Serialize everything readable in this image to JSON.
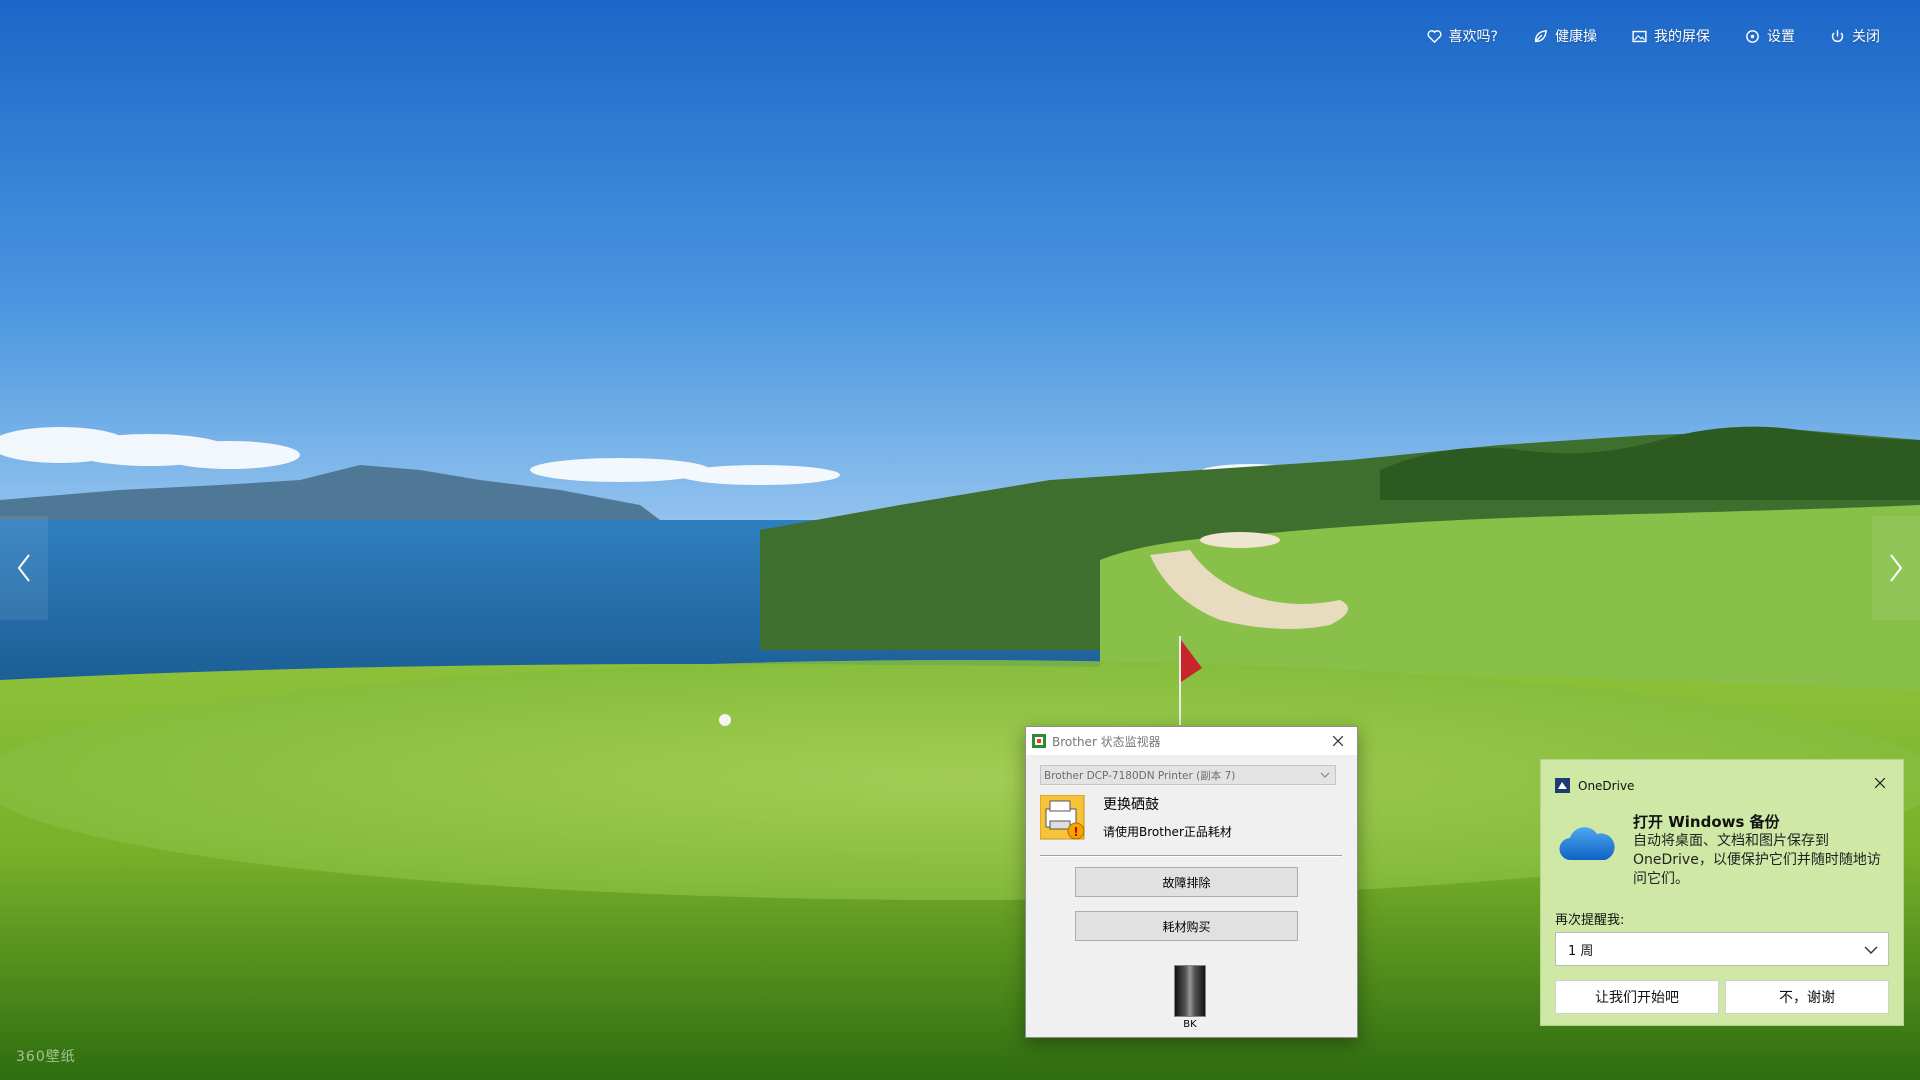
{
  "topnav": {
    "like": "喜欢吗?",
    "health": "健康操",
    "my_screensaver": "我的屏保",
    "settings": "设置",
    "close": "关闭"
  },
  "watermark": "360壁纸",
  "brother_dialog": {
    "title": "Brother 状态监视器",
    "printer_select": "Brother DCP-7180DN Printer (副本 7)",
    "status_main": "更换硒鼓",
    "status_sub": "请使用Brother正品耗材",
    "troubleshoot_button": "故障排除",
    "buy_supplies_button": "耗材购买",
    "toner_label": "BK",
    "toner_level": 1.0,
    "icon": "printer-warning-icon"
  },
  "onedrive_toast": {
    "app_name": "OneDrive",
    "title": "打开 Windows 备份",
    "body": "自动将桌面、文档和图片保存到 OneDrive，以便保护它们并随时随地访问它们。",
    "remind_label": "再次提醒我:",
    "remind_value": "1 周",
    "start_button": "让我们开始吧",
    "no_thanks_button": "不，谢谢",
    "accent": "#1a73e8",
    "background": "#cfe8a6"
  }
}
